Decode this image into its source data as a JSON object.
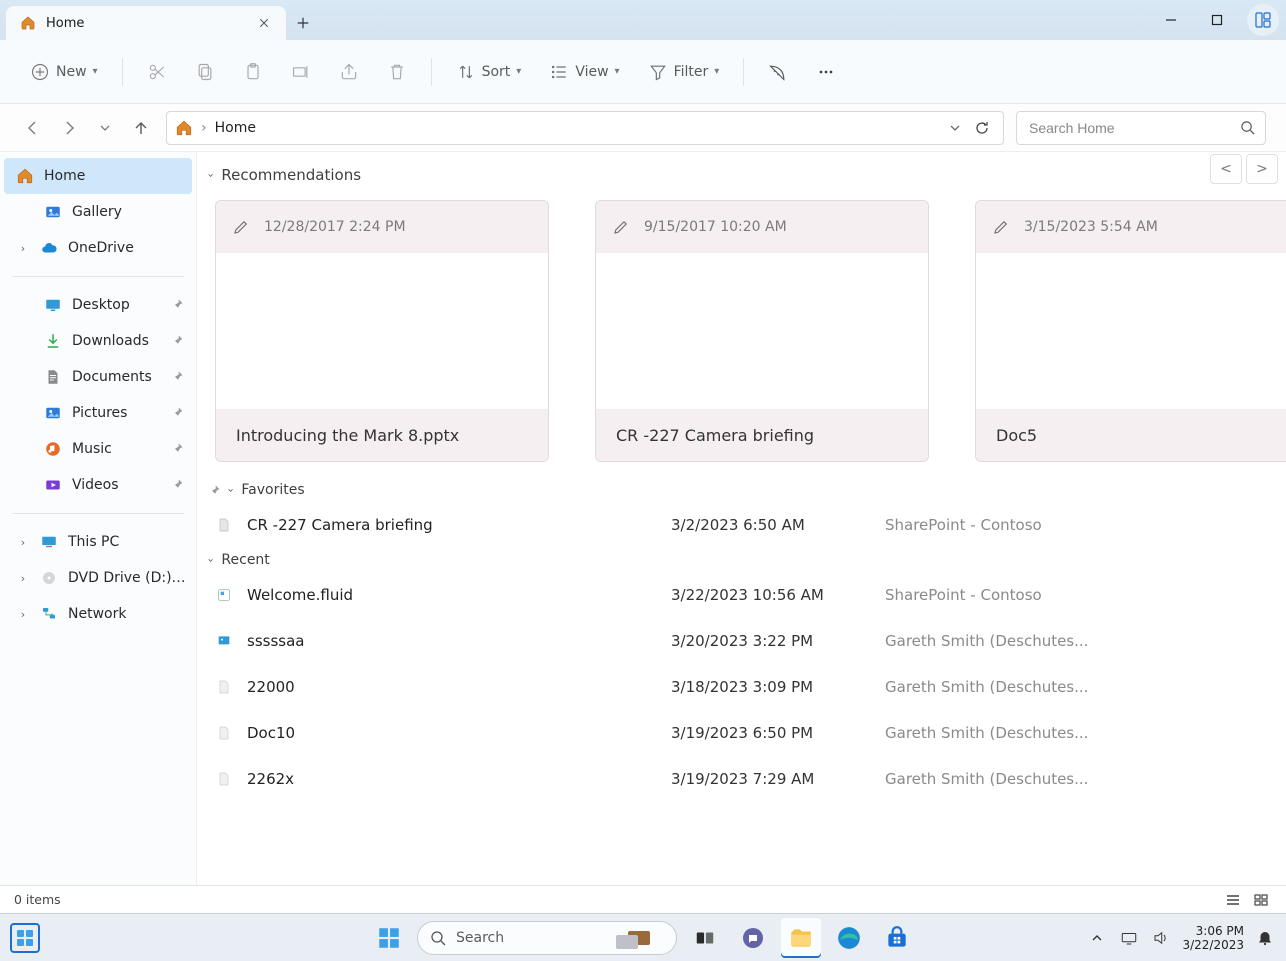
{
  "window": {
    "tab_title": "Home",
    "addr_crumb": "Home"
  },
  "toolbar": {
    "new": "New",
    "sort": "Sort",
    "view": "View",
    "filter": "Filter"
  },
  "search": {
    "placeholder": "Search Home"
  },
  "sidebar": {
    "home": "Home",
    "gallery": "Gallery",
    "onedrive": "OneDrive",
    "desktop": "Desktop",
    "downloads": "Downloads",
    "documents": "Documents",
    "pictures": "Pictures",
    "music": "Music",
    "videos": "Videos",
    "thispc": "This PC",
    "dvd": "DVD Drive (D:) ViVe",
    "network": "Network"
  },
  "sections": {
    "recommendations": "Recommendations",
    "favorites": "Favorites",
    "recent": "Recent"
  },
  "cards": [
    {
      "timestamp": "12/28/2017 2:24 PM",
      "title": "Introducing the Mark 8.pptx"
    },
    {
      "timestamp": "9/15/2017 10:20 AM",
      "title": "CR -227 Camera briefing"
    },
    {
      "timestamp": "3/15/2023 5:54 AM",
      "title": "Doc5"
    }
  ],
  "favorites": [
    {
      "name": "CR -227 Camera briefing",
      "date": "3/2/2023 6:50 AM",
      "meta": "SharePoint - Contoso"
    }
  ],
  "recent": [
    {
      "name": "Welcome.fluid",
      "date": "3/22/2023 10:56 AM",
      "meta": "SharePoint - Contoso"
    },
    {
      "name": "sssssaa",
      "date": "3/20/2023 3:22 PM",
      "meta": "Gareth Smith (Deschutes..."
    },
    {
      "name": "22000",
      "date": "3/18/2023 3:09 PM",
      "meta": "Gareth Smith (Deschutes..."
    },
    {
      "name": "Doc10",
      "date": "3/19/2023 6:50 PM",
      "meta": "Gareth Smith (Deschutes..."
    },
    {
      "name": "2262x",
      "date": "3/19/2023 7:29 AM",
      "meta": "Gareth Smith (Deschutes..."
    }
  ],
  "status": {
    "items": "0 items"
  },
  "taskbar": {
    "search_placeholder": "Search",
    "time": "3:06 PM",
    "date": "3/22/2023"
  },
  "nav_buttons": {
    "prev": "<",
    "next": ">"
  }
}
